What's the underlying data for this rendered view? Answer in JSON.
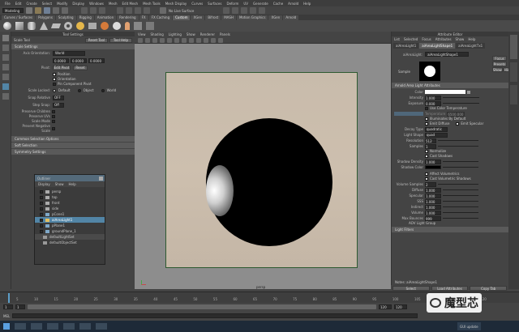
{
  "menubar": {
    "items": [
      "File",
      "Edit",
      "Create",
      "Select",
      "Modify",
      "Display",
      "Windows",
      "Mesh",
      "Edit Mesh",
      "Mesh Tools",
      "Mesh Display",
      "Curves",
      "Surfaces",
      "Deform",
      "UV",
      "Generate",
      "Cache",
      "Arnold",
      "Help"
    ]
  },
  "statusline": {
    "mode": "Modeling",
    "live_surface": "No Live Surface"
  },
  "shelf_tabs": [
    "Curves / Surfaces",
    "Polygons",
    "Sculpting",
    "Rigging",
    "Animation",
    "Rendering",
    "FX",
    "FX Caching",
    "Custom",
    "XGen",
    "Bifrost",
    "MASH",
    "Motion Graphics",
    "XGen",
    "Arnold"
  ],
  "tool_settings": {
    "title": "Tool Settings",
    "tool_name": "Scale Tool",
    "reset_label": "Reset Tool",
    "help_label": "Tool Help",
    "sections": {
      "scale_settings": "Scale Settings",
      "common_selection": "Common Selection Options",
      "soft_selection": "Soft Selection",
      "symmetry": "Symmetry Settings"
    },
    "axis_orientation_label": "Axis Orientation:",
    "axis_orientation_value": "World",
    "values": [
      "0.0000",
      "0.0000",
      "0.0000"
    ],
    "pivot_label": "Pivot:",
    "edit_pivot": "Edit Pivot",
    "reset": "Reset",
    "options": [
      "Position",
      "Orientation",
      "Pin Component Pivot"
    ],
    "snap_label": "Snap Relative",
    "snap_value": "OFF",
    "step_snap_label": "Step Snap:",
    "step_snap_value": "Off",
    "preserve_children": "Preserve Children",
    "preserve_uvs": "Preserve UVs",
    "scale_mode": "Scale Mode",
    "prevent_negative": "Prevent Negative Scale",
    "object_mode_label": "Scale Locked:",
    "object_options": [
      "Default",
      "Object",
      "World"
    ]
  },
  "viewport": {
    "menu": [
      "View",
      "Shading",
      "Lighting",
      "Show",
      "Renderer",
      "Panels"
    ],
    "label": "persp"
  },
  "outliner": {
    "title": "Outliner",
    "menu": [
      "Display",
      "Show",
      "Help"
    ],
    "items": [
      "persp",
      "top",
      "front",
      "side",
      "pCone1",
      "aiAreaLight1",
      "pPlane1",
      "groundPlane_1",
      "defaultLightSet",
      "defaultObjectSet"
    ],
    "selected_item": "aiAreaLight1"
  },
  "attribute_editor": {
    "title": "Attribute Editor",
    "menu": [
      "List",
      "Selected",
      "Focus",
      "Attributes",
      "Show",
      "Help"
    ],
    "tabs": [
      "aiAreaLight1",
      "aiAreaLightShape1",
      "aiAreaLightTx1"
    ],
    "node_label": "aiAreaLight:",
    "node_value": "aiAreaLightShape1",
    "focus_btn": "Focus",
    "presets_btn": "Presets",
    "show_btn": "Show",
    "hide_btn": "Hide",
    "sample_caption": "Sample",
    "section_main": "Arnold Area Light Attributes",
    "section_light_filters": "Light Filters",
    "rows": [
      {
        "label": "Color",
        "value": ""
      },
      {
        "label": "Intensity",
        "value": "1.000"
      },
      {
        "label": "Exposure",
        "value": "0.000"
      }
    ],
    "use_color_temp": "Use Color Temperature",
    "temperature_label": "Temperature",
    "temperature_value": "6500.000",
    "illuminates_default": "Illuminates By Default",
    "emit_diffuse": "Emit Diffuse",
    "emit_specular": "Emit Specular",
    "decay_label": "Decay Type",
    "decay_value": "quadratic",
    "light_shape_label": "Light Shape",
    "light_shape_value": "quad",
    "resolution_label": "Resolution",
    "resolution_value": "512",
    "samples_label": "Samples",
    "samples_value": "1",
    "normalize": "Normalize",
    "cast_shadows": "Cast Shadows",
    "shadow_density_label": "Shadow Density",
    "shadow_density_value": "1.000",
    "shadow_color_label": "Shadow Color",
    "affect_volumetrics": "Affect Volumetrics",
    "cast_volumetric": "Cast Volumetric Shadows",
    "volume_samples_label": "Volume Samples",
    "volume_samples_value": "2",
    "aov_rows": [
      {
        "label": "Diffuse",
        "value": "1.000"
      },
      {
        "label": "Specular",
        "value": "1.000"
      },
      {
        "label": "SSS",
        "value": "1.000"
      },
      {
        "label": "Indirect",
        "value": "1.000"
      },
      {
        "label": "Volume",
        "value": "1.000"
      }
    ],
    "max_bounces_label": "Max Bounces",
    "max_bounces_value": "999",
    "aov_light_group": "AOV Light Group",
    "notes_label": "Notes: aiAreaLightShape1",
    "select_btn": "Select",
    "load_btn": "Load Attributes",
    "copy_btn": "Copy Tab"
  },
  "timeline": {
    "ticks": [
      "5",
      "10",
      "15",
      "20",
      "25",
      "30",
      "35",
      "40",
      "45",
      "50",
      "55",
      "60",
      "65",
      "70",
      "75",
      "80",
      "85",
      "90",
      "95",
      "100",
      "105",
      "110",
      "115",
      "120"
    ],
    "start": "1",
    "end": "120",
    "range_start": "1",
    "range_end": "120",
    "current": "1"
  },
  "bottom": {
    "mel_label": "MEL",
    "watermark": "魔型芯",
    "gui_update": "GUI update"
  },
  "colors": {
    "bg": "#444444",
    "panel": "#4a4a4a",
    "viewport_bg": "#8d8d8d",
    "plane": "#c9bcab",
    "selected": "#5285a6",
    "sphere": "#000000"
  }
}
